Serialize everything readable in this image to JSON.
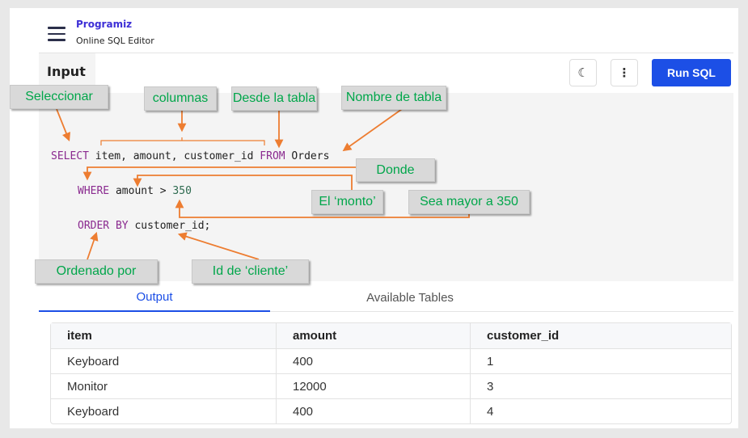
{
  "header": {
    "logo": "Programiz",
    "subtitle": "Online SQL Editor"
  },
  "toolbar": {
    "input_tab": "Input",
    "run_label": "Run SQL"
  },
  "code": {
    "line1": [
      {
        "t": "SELECT",
        "k": "kw"
      },
      {
        "t": " item, amount, customer_id ",
        "k": ""
      },
      {
        "t": "FROM",
        "k": "kw"
      },
      {
        "t": " Orders",
        "k": ""
      }
    ],
    "line2": [
      {
        "t": "WHERE",
        "k": "kw"
      },
      {
        "t": " amount > ",
        "k": ""
      },
      {
        "t": "350",
        "k": "num"
      }
    ],
    "line3": [
      {
        "t": "ORDER BY",
        "k": "kw"
      },
      {
        "t": " customer_id;",
        "k": ""
      }
    ]
  },
  "annotations": {
    "select": "Seleccionar",
    "columns": "columnas",
    "from": "Desde la tabla",
    "table_name": "Nombre de tabla",
    "where": "Donde",
    "amount": "El ‘monto’",
    "greater": "Sea mayor a 350",
    "order_by": "Ordenado por",
    "customer": "Id de ‘cliente’"
  },
  "output": {
    "tabs": [
      "Output",
      "Available Tables"
    ],
    "columns": [
      "item",
      "amount",
      "customer_id"
    ],
    "rows": [
      [
        "Keyboard",
        "400",
        "1"
      ],
      [
        "Monitor",
        "12000",
        "3"
      ],
      [
        "Keyboard",
        "400",
        "4"
      ]
    ]
  },
  "colors": {
    "accent": "#1c4fe6",
    "annotation_text": "#00a64a",
    "arrow": "#ed7d31"
  }
}
